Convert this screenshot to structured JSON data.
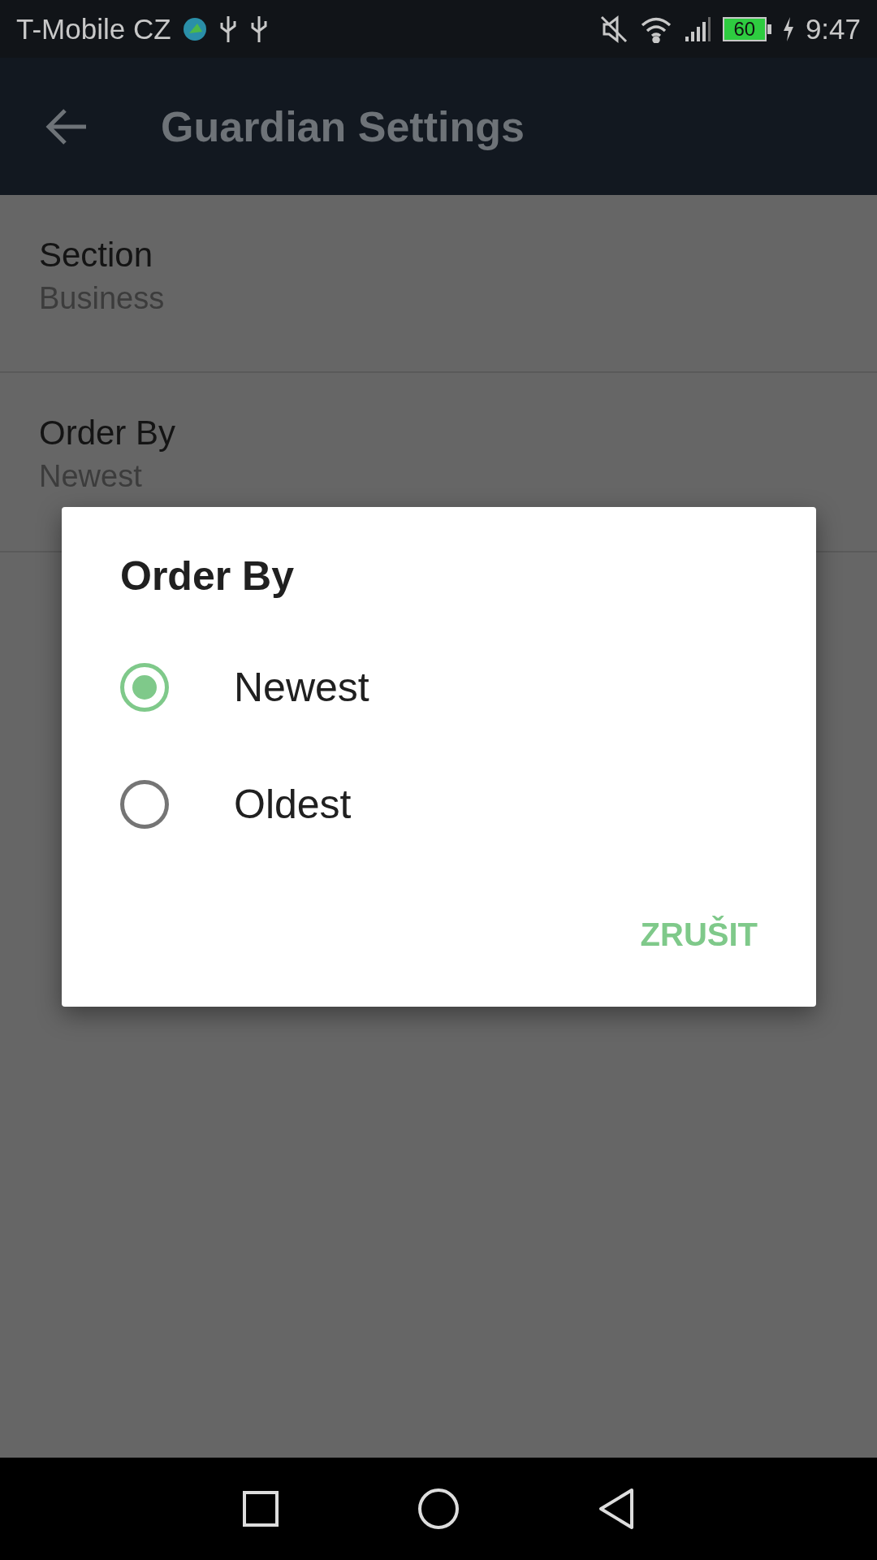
{
  "status_bar": {
    "carrier": "T-Mobile CZ",
    "battery": "60",
    "time": "9:47"
  },
  "app_bar": {
    "title": "Guardian Settings"
  },
  "settings": [
    {
      "title": "Section",
      "value": "Business"
    },
    {
      "title": "Order By",
      "value": "Newest"
    }
  ],
  "dialog": {
    "title": "Order By",
    "options": [
      {
        "label": "Newest",
        "selected": true
      },
      {
        "label": "Oldest",
        "selected": false
      }
    ],
    "buttons": [
      "ZRUŠIT"
    ]
  }
}
